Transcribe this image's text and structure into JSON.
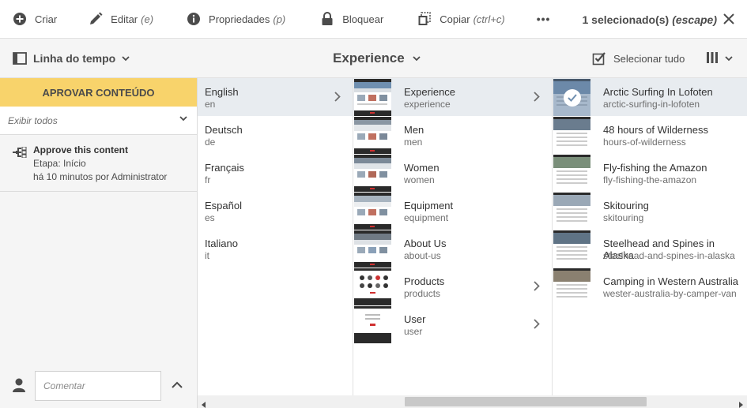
{
  "actionbar": {
    "create": "Criar",
    "edit": "Editar",
    "edit_shortcut": "(e)",
    "properties": "Propriedades",
    "properties_shortcut": "(p)",
    "lock": "Bloquear",
    "copy": "Copiar",
    "copy_shortcut": "(ctrl+c)",
    "more": "•••",
    "selection": "1 selecionado(s)",
    "selection_shortcut": "(escape)"
  },
  "titlebar": {
    "rail_label": "Linha do tempo",
    "title": "Experience",
    "select_all": "Selecionar tudo"
  },
  "rail": {
    "approve_button": "APROVAR CONTEÚDO",
    "filter_value": "Exibir todos",
    "timeline": {
      "title": "Approve this content",
      "step": "Etapa: Início",
      "meta": "há 10 minutos por Administrator"
    },
    "comment_placeholder": "Comentar"
  },
  "columns": {
    "languages": [
      {
        "name": "English",
        "sub": "en",
        "active": true,
        "has_children": true
      },
      {
        "name": "Deutsch",
        "sub": "de"
      },
      {
        "name": "Français",
        "sub": "fr"
      },
      {
        "name": "Español",
        "sub": "es"
      },
      {
        "name": "Italiano",
        "sub": "it"
      }
    ],
    "sections": [
      {
        "name": "Experience",
        "sub": "experience",
        "active": true,
        "has_children": true
      },
      {
        "name": "Men",
        "sub": "men"
      },
      {
        "name": "Women",
        "sub": "women"
      },
      {
        "name": "Equipment",
        "sub": "equipment"
      },
      {
        "name": "About Us",
        "sub": "about-us"
      },
      {
        "name": "Products",
        "sub": "products",
        "has_children": true
      },
      {
        "name": "User",
        "sub": "user",
        "has_children": true
      }
    ],
    "pages": [
      {
        "name": "Arctic Surfing In Lofoten",
        "sub": "arctic-surfing-in-lofoten",
        "active": true,
        "selected": true
      },
      {
        "name": "48 hours of Wilderness",
        "sub": "hours-of-wilderness"
      },
      {
        "name": "Fly-fishing the Amazon",
        "sub": "fly-fishing-the-amazon"
      },
      {
        "name": "Skitouring",
        "sub": "skitouring"
      },
      {
        "name": "Steelhead and Spines in Alaska",
        "sub": "steelhead-and-spines-in-alaska"
      },
      {
        "name": "Camping in Western Australia",
        "sub": "wester-australia-by-camper-van"
      }
    ]
  },
  "colors": {
    "approve_bg": "#f8d36b",
    "active_row": "#e8ecf0",
    "rail_bg": "#f5f5f5"
  }
}
